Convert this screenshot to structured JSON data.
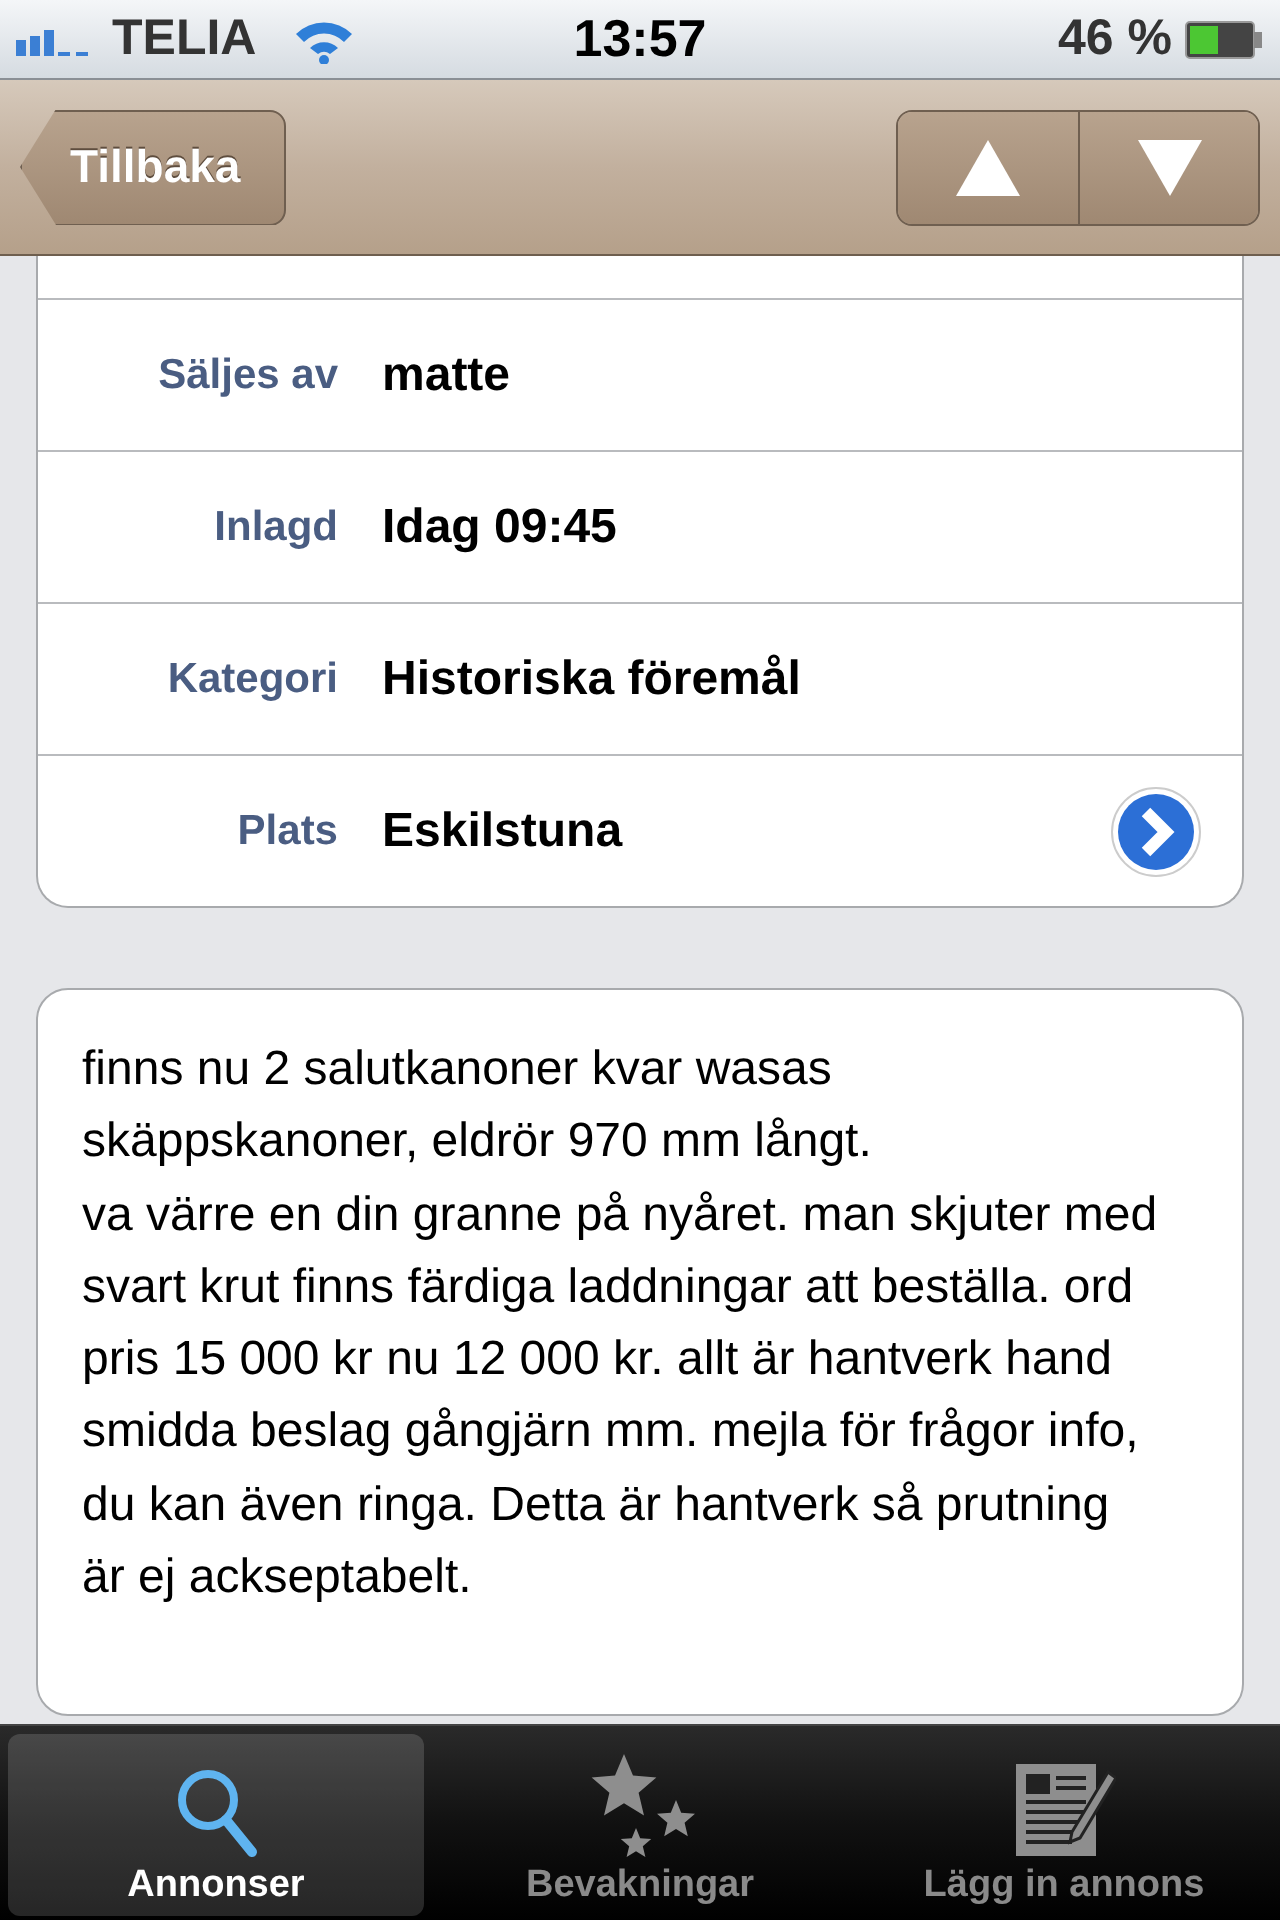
{
  "status_bar": {
    "carrier": "TELIA",
    "time": "13:57",
    "battery": "46 %"
  },
  "nav_bar": {
    "back": "Tillbaka"
  },
  "details": [
    {
      "label": "Säljes av",
      "value": "matte",
      "detail_button": false
    },
    {
      "label": "Inlagd",
      "value": "Idag 09:45",
      "detail_button": false
    },
    {
      "label": "Kategori",
      "value": "Historiska föremål",
      "detail_button": false
    },
    {
      "label": "Plats",
      "value": "Eskilstuna",
      "detail_button": true
    }
  ],
  "description": "finns nu 2 salutkanoner kvar wasas skäppskanoner, eldrör 970 mm långt.\nva värre en din granne på nyåret. man skjuter med svart krut finns färdiga laddningar att beställa. ord pris 15 000 kr nu 12 000 kr. allt är hantverk hand smidda beslag gångjärn mm. mejla för frågor info, du kan även ringa. Detta är hantverk så prutning är ej ackseptabelt.",
  "tab_bar": [
    {
      "kind": "search",
      "label": "Annonser",
      "selected": true
    },
    {
      "kind": "stars",
      "label": "Bevakningar",
      "selected": false
    },
    {
      "kind": "compose",
      "label": "Lägg in annons",
      "selected": false
    }
  ]
}
